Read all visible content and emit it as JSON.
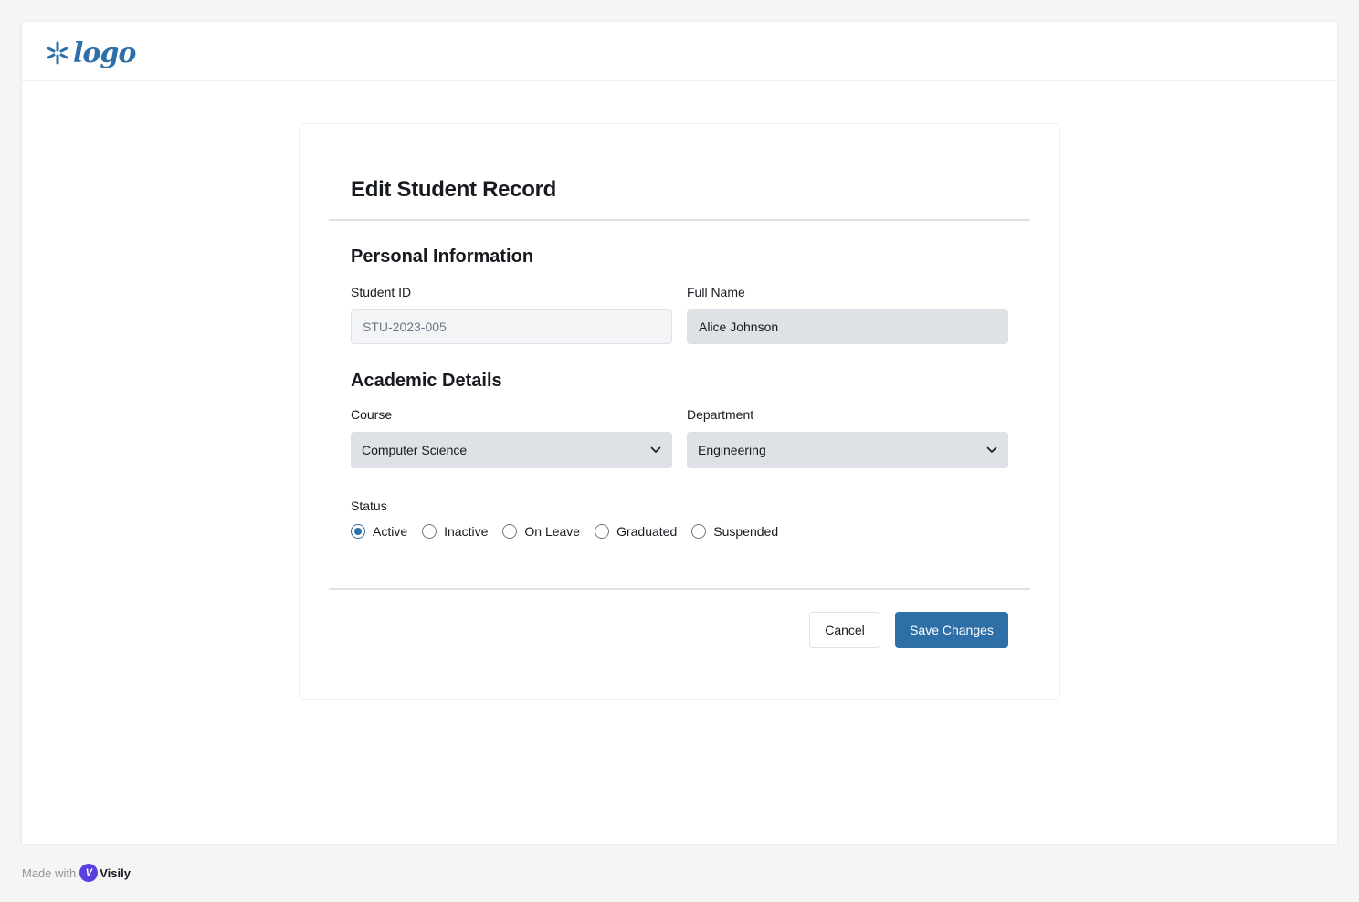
{
  "header": {
    "logo_text": "logo"
  },
  "form": {
    "title": "Edit Student Record",
    "personal_section": "Personal Information",
    "student_id": {
      "label": "Student ID",
      "value": "STU-2023-005"
    },
    "full_name": {
      "label": "Full Name",
      "value": "Alice Johnson"
    },
    "academic_section": "Academic Details",
    "course": {
      "label": "Course",
      "value": "Computer Science"
    },
    "department": {
      "label": "Department",
      "value": "Engineering"
    },
    "status": {
      "label": "Status",
      "selected": "Active",
      "options": [
        "Active",
        "Inactive",
        "On Leave",
        "Graduated",
        "Suspended"
      ]
    },
    "cancel_label": "Cancel",
    "save_label": "Save Changes"
  },
  "footer": {
    "made_with": "Made with",
    "brand": "Visily",
    "brand_badge": "V"
  },
  "colors": {
    "accent": "#2e6fa7",
    "field_bg": "#dee1e6",
    "disabled_bg": "#f3f4f6",
    "brand_badge": "#5b3fe0"
  },
  "icons": {
    "logo": "asterisk-logo-icon",
    "select_chevron": "chevron-down-icon"
  }
}
